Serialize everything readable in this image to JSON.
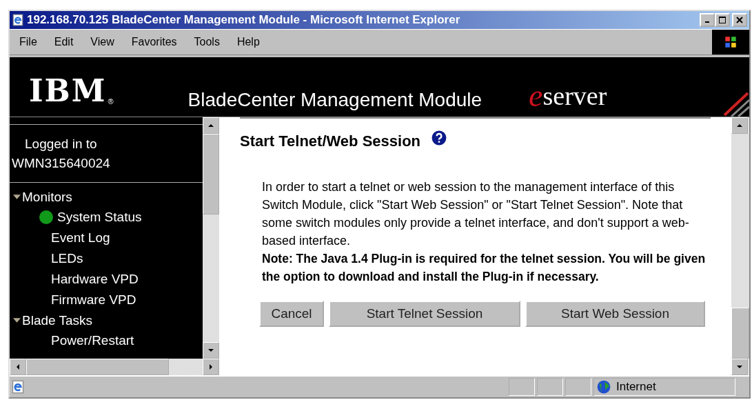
{
  "window": {
    "title": "192.168.70.125 BladeCenter Management Module - Microsoft Internet Explorer"
  },
  "menu": [
    "File",
    "Edit",
    "View",
    "Favorites",
    "Tools",
    "Help"
  ],
  "header": {
    "logo": "IBM",
    "registered": "®",
    "title": "BladeCenter Management Module",
    "brand_mark": "e",
    "brand": "server"
  },
  "sidebar": {
    "logged_in_label": "Logged in to",
    "host": "WMN315640024",
    "tree": [
      {
        "label": "Monitors",
        "expanded": true,
        "children": [
          {
            "label": "System Status",
            "color": "#11991a"
          },
          {
            "label": "Event Log"
          },
          {
            "label": "LEDs"
          },
          {
            "label": "Hardware VPD"
          },
          {
            "label": "Firmware VPD"
          }
        ]
      },
      {
        "label": "Blade Tasks",
        "expanded": true,
        "children": [
          {
            "label": "Power/Restart"
          }
        ]
      }
    ]
  },
  "main": {
    "heading": "Start Telnet/Web Session",
    "paragraph": "In order to start a telnet or web session to the management interface of this Switch Module, click \"Start Web Session\" or \"Start Telnet Session\". Note that some switch modules only provide a telnet interface, and don't support a web-based interface.",
    "note": "Note: The Java 1.4 Plug-in is required for the telnet session. You will be given the option to download and install the Plug-in if necessary.",
    "buttons": [
      "Cancel",
      "Start Telnet Session",
      "Start Web Session"
    ]
  },
  "status_bar": {
    "zone": "Internet"
  }
}
